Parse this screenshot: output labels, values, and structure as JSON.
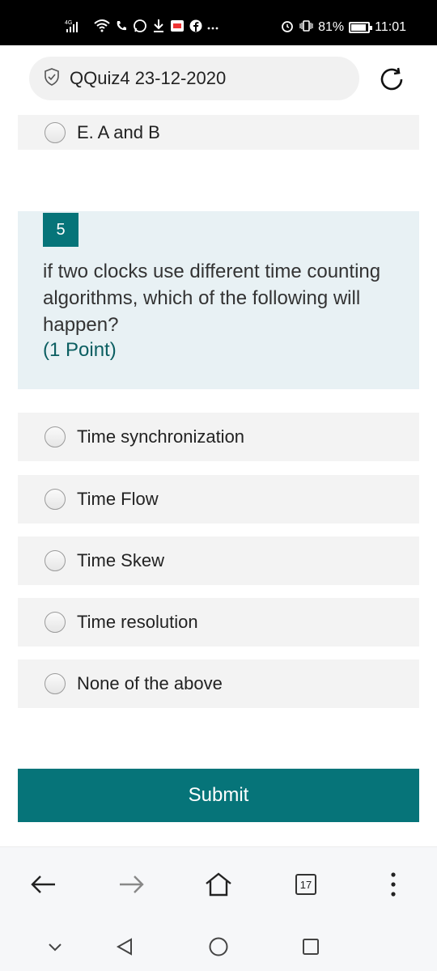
{
  "status_bar": {
    "network": "4G",
    "battery_text": "81%",
    "battery_level": 0.81,
    "time": "11:01",
    "icons": [
      "signal-icon",
      "wifi-icon",
      "phone-icon",
      "whatsapp-icon",
      "download-icon",
      "app-icon",
      "facebook-icon",
      "more-icon",
      "alarm-icon",
      "vibrate-icon",
      "battery-icon"
    ]
  },
  "address_bar": {
    "title": "QQuiz4 23-12-2020",
    "icon": "shield-check-icon",
    "refresh_icon": "refresh-icon"
  },
  "previous_option": {
    "label": "E. A and B"
  },
  "question": {
    "number": "5",
    "text": "if two clocks use different time counting algorithms, which of the following will happen?",
    "points": "(1 Point)"
  },
  "options": [
    {
      "label": "Time synchronization"
    },
    {
      "label": "Time Flow"
    },
    {
      "label": "Time Skew"
    },
    {
      "label": "Time resolution"
    },
    {
      "label": "None of the above"
    }
  ],
  "submit": {
    "label": "Submit"
  },
  "browser_toolbar": {
    "tabs_count": "17",
    "icons": [
      "back-arrow-icon",
      "forward-arrow-icon",
      "home-icon",
      "tabs-icon",
      "menu-dots-icon"
    ]
  },
  "nav_bar": {
    "icons": [
      "collapse-chevron-icon",
      "back-triangle-icon",
      "home-circle-icon",
      "recents-square-icon"
    ]
  },
  "colors": {
    "accent": "#067479",
    "question_bg": "#e8f1f4",
    "option_bg": "#f3f3f3",
    "points_text": "#0b5e61"
  }
}
